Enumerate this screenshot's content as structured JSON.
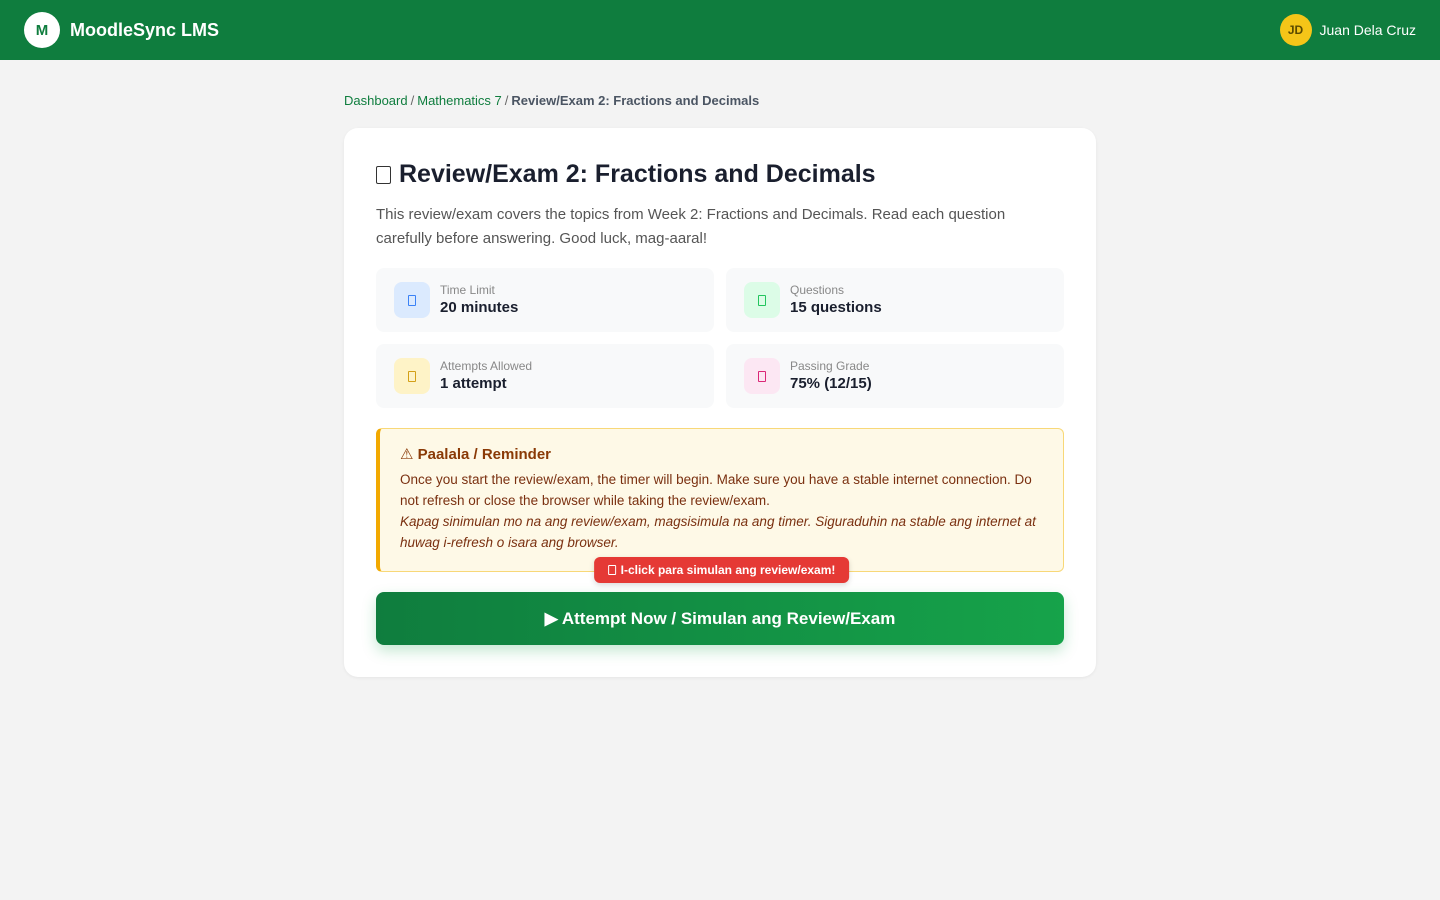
{
  "app": {
    "logo_letter": "M",
    "title": "MoodleSync LMS"
  },
  "user": {
    "initials": "JD",
    "name": "Juan Dela Cruz"
  },
  "breadcrumb": {
    "items": [
      "Dashboard",
      "Mathematics 7"
    ],
    "separator": "/",
    "current": "Review/Exam 2: Fractions and Decimals"
  },
  "exam": {
    "title": "Review/Exam 2: Fractions and Decimals",
    "description": "This review/exam covers the topics from Week 2: Fractions and Decimals. Read each question carefully before answering. Good luck, mag-aaral!"
  },
  "info": [
    {
      "label": "Time Limit",
      "value": "20 minutes",
      "icon": "clock-icon",
      "bg": "#dbeafe",
      "fg": "#3b82f6"
    },
    {
      "label": "Questions",
      "value": "15 questions",
      "icon": "questions-icon",
      "bg": "#dcfce7",
      "fg": "#22c55e"
    },
    {
      "label": "Attempts Allowed",
      "value": "1 attempt",
      "icon": "attempts-icon",
      "bg": "#fef3c7",
      "fg": "#d4a017"
    },
    {
      "label": "Passing Grade",
      "value": "75% (12/15)",
      "icon": "passing-grade-icon",
      "bg": "#fce7f3",
      "fg": "#db2777"
    }
  ],
  "reminder": {
    "title": "⚠ Paalala / Reminder",
    "text_en": "Once you start the review/exam, the timer will begin. Make sure you have a stable internet connection. Do not refresh or close the browser while taking the review/exam.",
    "text_fil": "Kapag sinimulan mo na ang review/exam, magsisimula na ang timer. Siguraduhin na stable ang internet at huwag i-refresh o isara ang browser."
  },
  "tooltip": {
    "text": "I-click para simulan ang review/exam!"
  },
  "attempt_button": {
    "label": "▶ Attempt Now / Simulan ang Review/Exam"
  },
  "colors": {
    "brand_green": "#0f7d3e",
    "accent_yellow": "#f5c518",
    "warning_border": "#f2a900",
    "tooltip_red": "#e53935"
  }
}
